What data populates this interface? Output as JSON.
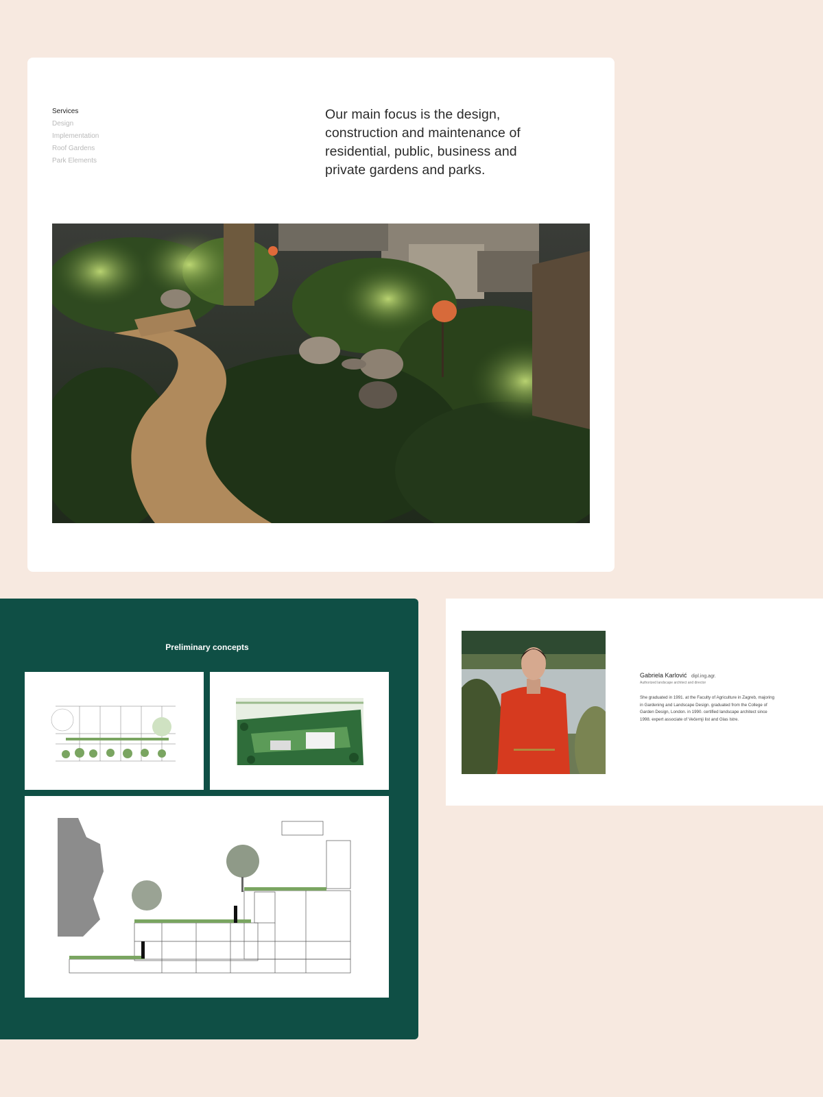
{
  "services": {
    "nav": [
      {
        "label": "Services",
        "active": true
      },
      {
        "label": "Design",
        "active": false
      },
      {
        "label": "Implementation",
        "active": false
      },
      {
        "label": "Roof Gardens",
        "active": false
      },
      {
        "label": "Park Elements",
        "active": false
      }
    ],
    "headline": "Our main focus is the design, construction and maintenance of residential, public, business and private gardens and parks."
  },
  "concepts": {
    "title": "Preliminary concepts"
  },
  "person": {
    "name": "Gabriela Karlović",
    "degree": "dipl.ing.agr.",
    "role": "Authorized landscape architect and director",
    "bio": "She graduated in 1991. at the Faculty of Agriculture in Zagreb, majoring in Gardening and Landscape Design. graduated from the College of Garden Design, London. in 1990. certified landscape architect since 1998. expert associate of Večernji list and Glas Istre."
  },
  "colors": {
    "background": "#f7e9e0",
    "panel": "#ffffff",
    "concepts_bg": "#0f4f45",
    "nav_active": "#222222",
    "nav_inactive": "#b9b9b9"
  }
}
